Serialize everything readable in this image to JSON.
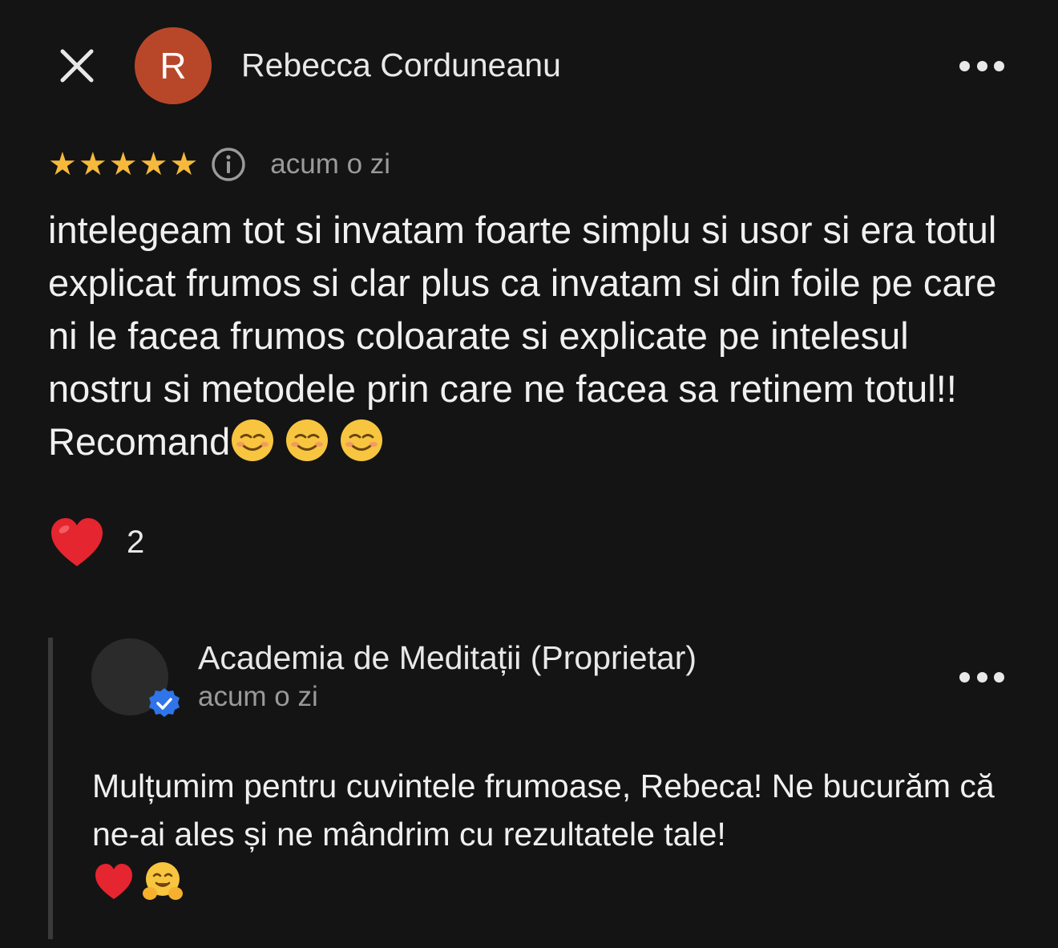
{
  "review": {
    "author_initial": "R",
    "author_name": "Rebecca Corduneanu",
    "rating": 5,
    "rating_max": 5,
    "time": "acum o zi",
    "text": "intelegeam tot si invatam foarte simplu si usor si era totul explicat frumos si clar plus ca invatam si din foile pe care ni le facea frumos coloarate si explicate pe intelesul nostru si metodele prin care ne facea sa retinem totul!! Recomand",
    "trailing_emojis": [
      "smiling-face-icon",
      "smiling-face-icon",
      "smiling-face-icon"
    ],
    "reaction_icon": "red-heart-icon",
    "reaction_count": "2"
  },
  "reply": {
    "owner_name": "Academia de Meditații (Proprietar)",
    "time": "acum o zi",
    "text": "Mulțumim pentru cuvintele frumoase, Rebeca! Ne bucurăm că ne-ai ales și ne mândrim cu rezultatele tale!",
    "trailing_emojis": [
      "red-heart-icon",
      "hugging-face-icon"
    ]
  },
  "icons": {
    "close": "close-icon",
    "more": "more-options-icon",
    "info": "info-icon",
    "verified": "verified-badge-icon",
    "star": "star-icon"
  },
  "colors": {
    "background": "#141414",
    "avatar": "#b8472a",
    "star": "#f6b93b",
    "verified": "#2f74e8",
    "heart": "#e5252f",
    "muted_text": "#9a9a9a"
  }
}
